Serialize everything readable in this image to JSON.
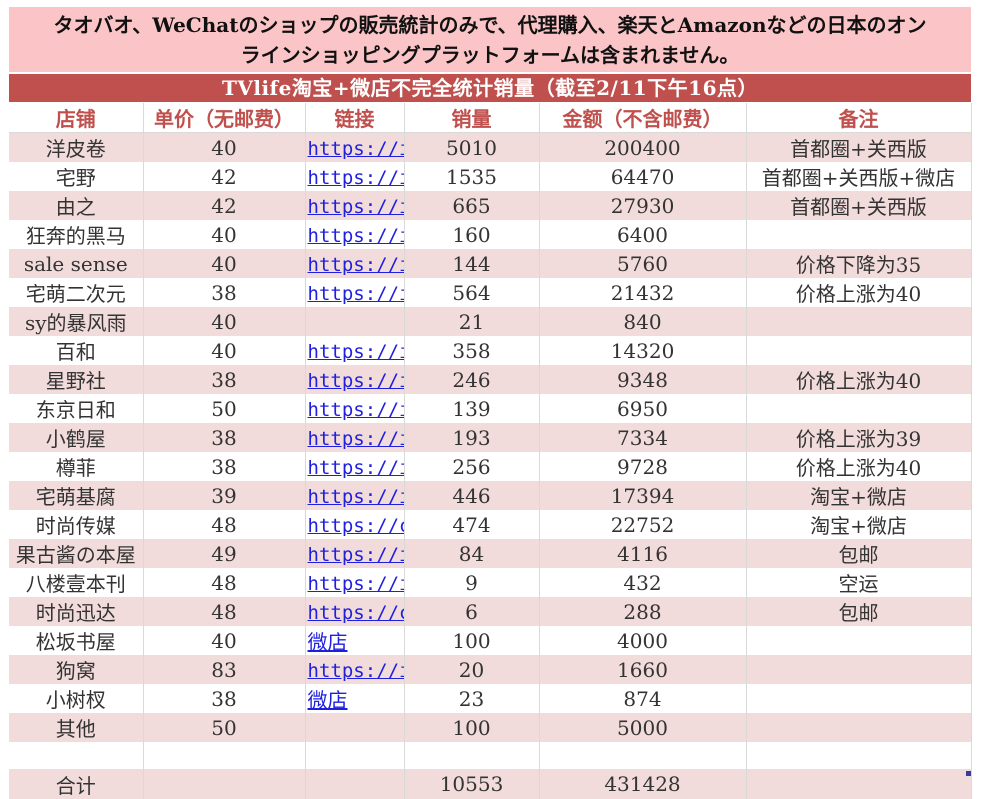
{
  "banner": {
    "line1": "タオバオ、WeChatのショップの販売統計のみで、代理購入、楽天とAmazonなどの日本のオン",
    "line2": "ラインショッピングプラットフォームは含まれません。"
  },
  "title": "TVlife淘宝+微店不完全统计销量（截至2/11下午16点）",
  "headers": [
    "店铺",
    "单价（无邮费）",
    "链接",
    "销量",
    "金额（不含邮费）",
    "备注"
  ],
  "rows": [
    {
      "store": "洋皮卷",
      "price": "40",
      "link": "https://i",
      "sales": "5010",
      "amount": "200400",
      "note": "首都圈+关西版"
    },
    {
      "store": "宅野",
      "price": "42",
      "link": "https://i",
      "sales": "1535",
      "amount": "64470",
      "note": "首都圈+关西版+微店"
    },
    {
      "store": "由之",
      "price": "42",
      "link": "https://i",
      "sales": "665",
      "amount": "27930",
      "note": "首都圈+关西版"
    },
    {
      "store": "狂奔的黑马",
      "price": "40",
      "link": "https://i",
      "sales": "160",
      "amount": "6400",
      "note": ""
    },
    {
      "store": "sale sense",
      "price": "40",
      "link": "https://i",
      "sales": "144",
      "amount": "5760",
      "note": "价格下降为35"
    },
    {
      "store": "宅萌二次元",
      "price": "38",
      "link": "https://i",
      "sales": "564",
      "amount": "21432",
      "note": "价格上涨为40"
    },
    {
      "store": "sy的暴风雨",
      "price": "40",
      "link": "",
      "sales": "21",
      "amount": "840",
      "note": ""
    },
    {
      "store": "百和",
      "price": "40",
      "link": "https://i",
      "sales": "358",
      "amount": "14320",
      "note": ""
    },
    {
      "store": "星野社",
      "price": "38",
      "link": "https://i",
      "sales": "246",
      "amount": "9348",
      "note": "价格上涨为40"
    },
    {
      "store": "东京日和",
      "price": "50",
      "link": "https://i",
      "sales": "139",
      "amount": "6950",
      "note": ""
    },
    {
      "store": "小鹤屋",
      "price": "38",
      "link": "https://i",
      "sales": "193",
      "amount": "7334",
      "note": "价格上涨为39"
    },
    {
      "store": "樽菲",
      "price": "38",
      "link": "https://i",
      "sales": "256",
      "amount": "9728",
      "note": "价格上涨为40"
    },
    {
      "store": "宅萌基腐",
      "price": "39",
      "link": "https://i",
      "sales": "446",
      "amount": "17394",
      "note": "淘宝+微店"
    },
    {
      "store": "时尚传媒",
      "price": "48",
      "link": "https://c",
      "sales": "474",
      "amount": "22752",
      "note": "淘宝+微店"
    },
    {
      "store": "果古酱の本屋",
      "price": "49",
      "link": "https://i",
      "sales": "84",
      "amount": "4116",
      "note": "包邮"
    },
    {
      "store": "八楼壹本刊",
      "price": "48",
      "link": "https://i",
      "sales": "9",
      "amount": "432",
      "note": "空运"
    },
    {
      "store": "时尚迅达",
      "price": "48",
      "link": "https://c",
      "sales": "6",
      "amount": "288",
      "note": "包邮"
    },
    {
      "store": "松坂书屋",
      "price": "40",
      "link": "微店",
      "sales": "100",
      "amount": "4000",
      "note": ""
    },
    {
      "store": "狗窝",
      "price": "83",
      "link": "https://i",
      "sales": "20",
      "amount": "1660",
      "note": ""
    },
    {
      "store": "小树杈",
      "price": "38",
      "link": "微店",
      "sales": "23",
      "amount": "874",
      "note": ""
    },
    {
      "store": "其他",
      "price": "50",
      "link": "",
      "sales": "100",
      "amount": "5000",
      "note": ""
    }
  ],
  "total": {
    "label": "合计",
    "sales": "10553",
    "amount": "431428"
  },
  "colors": {
    "banner_bg": "#fbc5c8",
    "title_bg": "#c0504d",
    "header_text": "#c0504d",
    "band": "#f2dcdb",
    "link": "#1f1fe0"
  }
}
